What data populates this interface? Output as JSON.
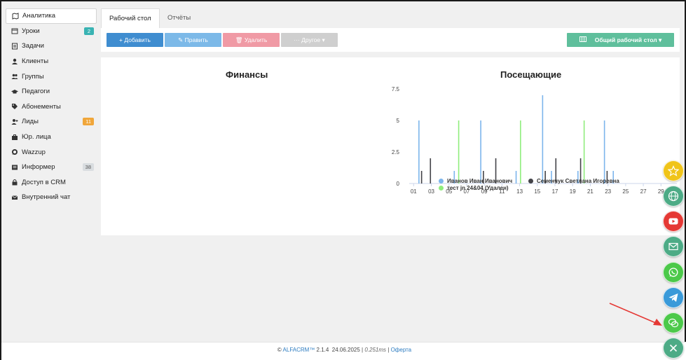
{
  "sidebar": {
    "items": [
      {
        "label": "Аналитика",
        "icon": "map-icon",
        "active": true
      },
      {
        "label": "Уроки",
        "icon": "calendar-icon",
        "badge": "2",
        "badge_color": "#39b3b3"
      },
      {
        "label": "Задачи",
        "icon": "checklist-icon"
      },
      {
        "label": "Клиенты",
        "icon": "user-icon"
      },
      {
        "label": "Группы",
        "icon": "users-icon"
      },
      {
        "label": "Педагоги",
        "icon": "graduation-cap-icon"
      },
      {
        "label": "Абонементы",
        "icon": "tag-icon"
      },
      {
        "label": "Лиды",
        "icon": "user-plus-icon",
        "badge": "11",
        "badge_color": "#f0a63a"
      },
      {
        "label": "Юр. лица",
        "icon": "briefcase-icon"
      },
      {
        "label": "Wazzup",
        "icon": "whatsapp-icon"
      },
      {
        "label": "Информер",
        "icon": "newspaper-icon",
        "badge": "38",
        "badge_color": "#d9dde0"
      },
      {
        "label": "Доступ в CRM",
        "icon": "lock-icon"
      },
      {
        "label": "Внутренний чат",
        "icon": "envelope-icon"
      }
    ]
  },
  "tabs": [
    {
      "label": "Рабочий стол",
      "active": true
    },
    {
      "label": "Отчёты",
      "active": false
    }
  ],
  "toolbar": {
    "add_label": "+ Добавить",
    "edit_label": "✎ Править",
    "delete_label": "🗑 Удалить",
    "other_label": "··· Другое ▾",
    "desk_label": "Общий рабочий стол ▾"
  },
  "colors": {
    "add": "#3f8dd0",
    "edit": "#7cb9e8",
    "delete": "#f09aa5",
    "other": "#cfcfcf",
    "desk": "#5fbf9c"
  },
  "finance": {
    "title": "Финансы"
  },
  "chart_data": {
    "type": "bar",
    "title": "Посещающие",
    "x_ticks": [
      "01",
      "03",
      "05",
      "07",
      "09",
      "11",
      "13",
      "15",
      "17",
      "19",
      "21",
      "23",
      "25",
      "27",
      "29"
    ],
    "ylim": [
      0,
      7.5
    ],
    "y_ticks": [
      "0",
      "2.5",
      "5",
      "7.5"
    ],
    "series": [
      {
        "name": "Иванов Иван Иванович",
        "color": "#7cb5ec",
        "points": [
          [
            1.6,
            5
          ],
          [
            5.6,
            1
          ],
          [
            8.6,
            5
          ],
          [
            12.6,
            1
          ],
          [
            15.6,
            7
          ],
          [
            16.6,
            1
          ],
          [
            19.6,
            1
          ],
          [
            22.6,
            5
          ],
          [
            23.6,
            1
          ]
        ]
      },
      {
        "name": "Семенчук Светлана Игоревна",
        "color": "#434348",
        "points": [
          [
            1.9,
            1
          ],
          [
            2.9,
            2
          ],
          [
            8.9,
            1
          ],
          [
            10.3,
            2
          ],
          [
            15.9,
            1
          ],
          [
            17.1,
            2
          ],
          [
            19.9,
            2
          ],
          [
            22.9,
            1
          ]
        ]
      },
      {
        "name": "тест jn 24&04 (Удален)",
        "color": "#90ed7d",
        "points": [
          [
            6.1,
            5
          ],
          [
            13.1,
            5
          ],
          [
            20.3,
            5
          ]
        ]
      }
    ],
    "legend": "bottom"
  },
  "footer": {
    "copyright": "© ",
    "brand": "ALFACRM™",
    "version": " 2.1.4  24.06.2025 | ",
    "time": "0.251ms",
    "sep": " | ",
    "offer": "Оферта"
  },
  "fabs": [
    {
      "icon": "star-icon",
      "color": "#f0c419"
    },
    {
      "icon": "globe-icon",
      "color": "#4dab86"
    },
    {
      "icon": "youtube-icon",
      "color": "#e53935"
    },
    {
      "icon": "mail-icon",
      "color": "#4dab86"
    },
    {
      "icon": "whatsapp-icon",
      "color": "#4cc94a"
    },
    {
      "icon": "telegram-icon",
      "color": "#3a9ad9"
    },
    {
      "icon": "chat-icon",
      "color": "#4cc94a"
    },
    {
      "icon": "close-icon",
      "color": "#4dab86"
    }
  ]
}
